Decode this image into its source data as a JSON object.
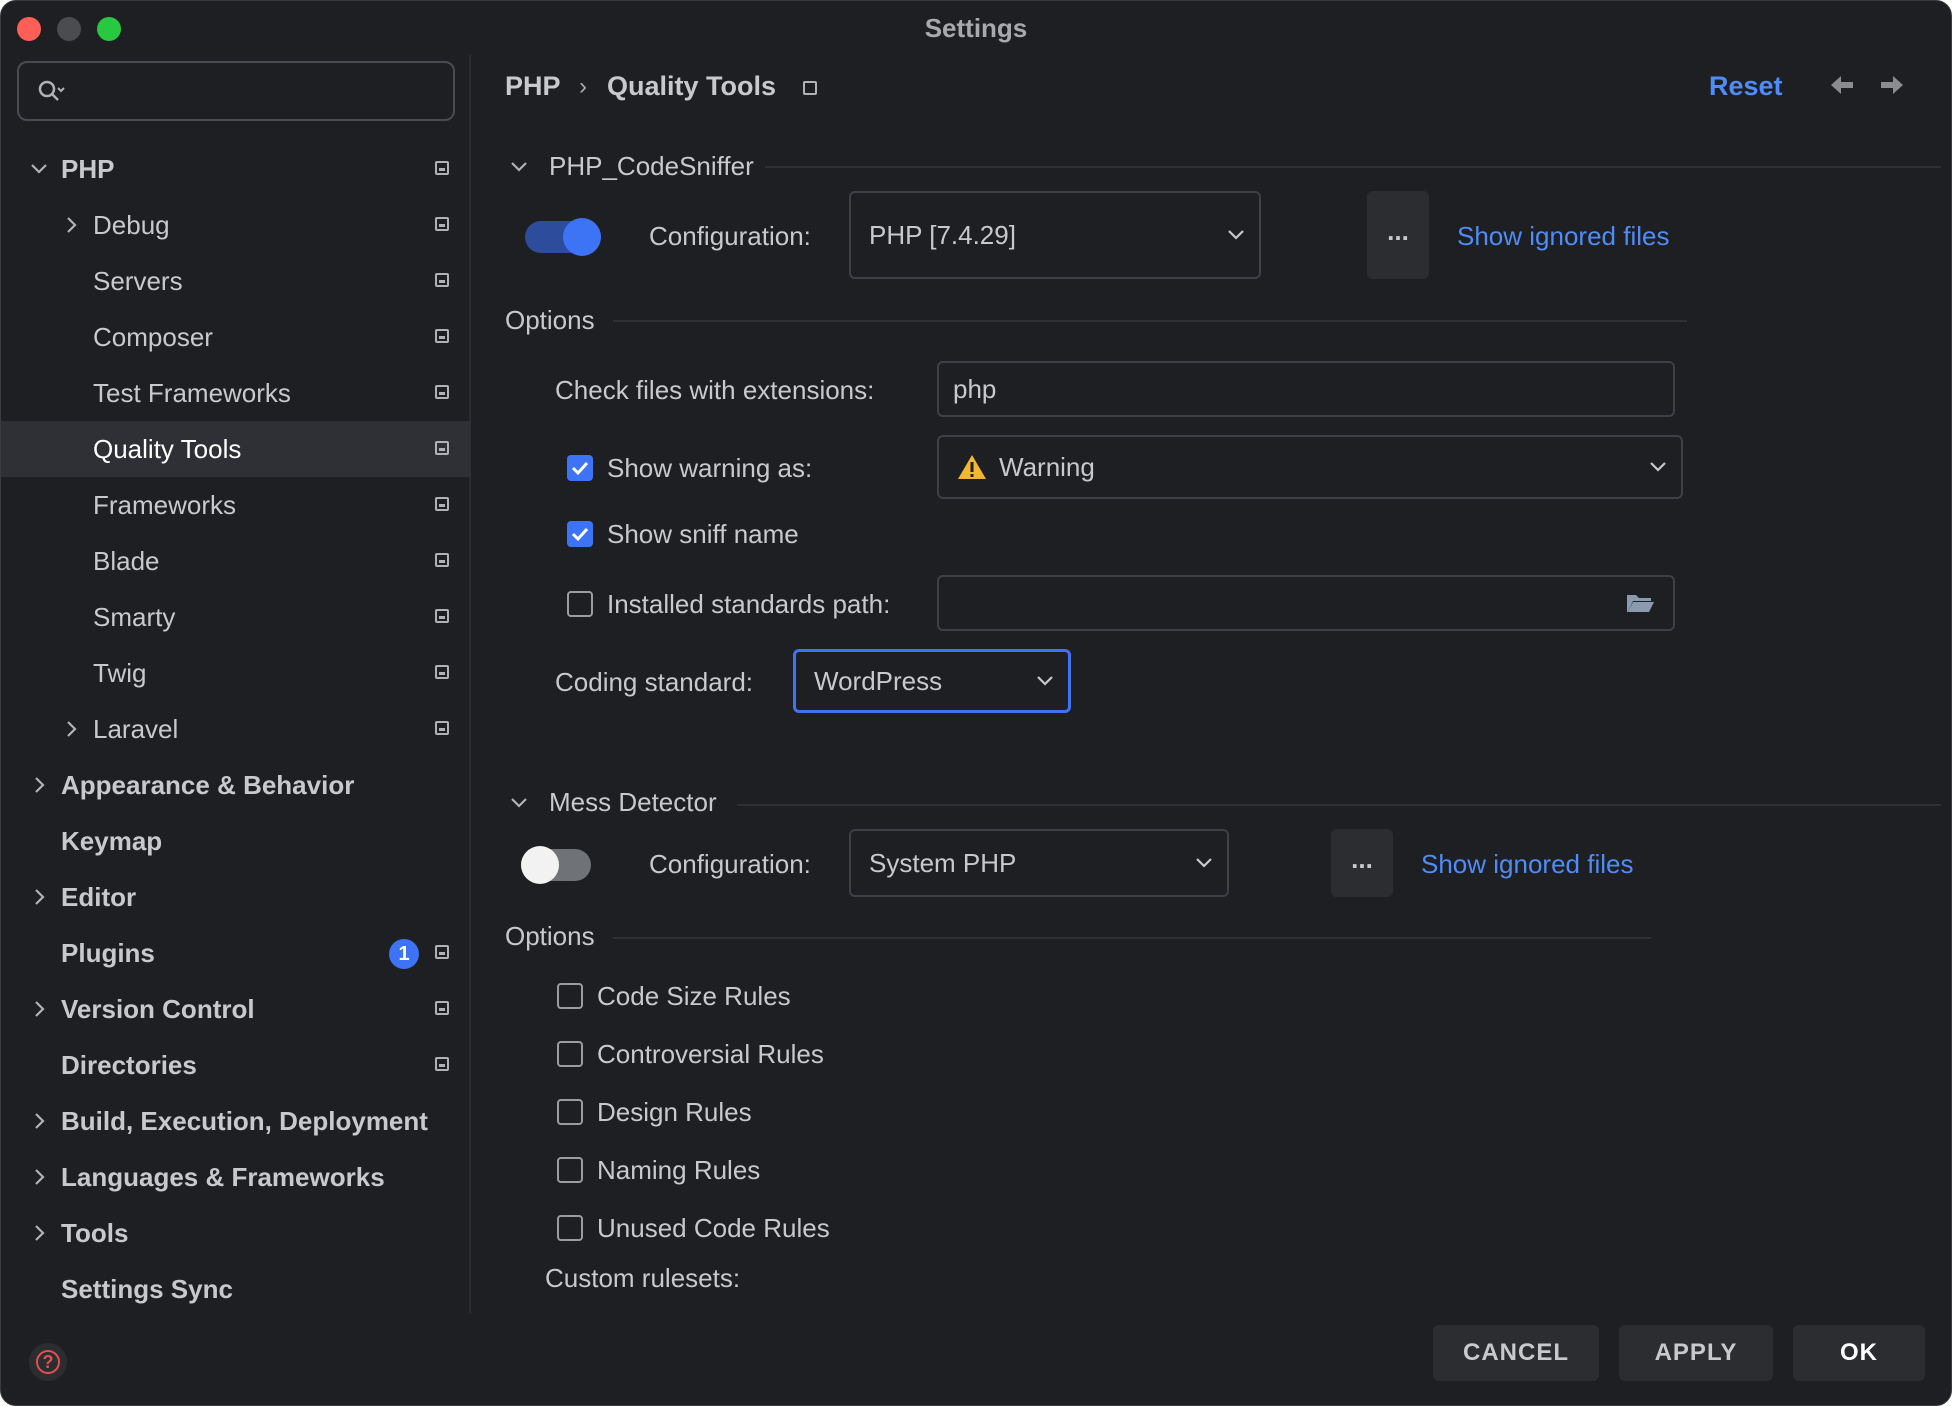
{
  "window": {
    "title": "Settings"
  },
  "sidebar": {
    "search_placeholder": "",
    "items": [
      {
        "label": "PHP",
        "expanded": true
      },
      {
        "label": "Debug"
      },
      {
        "label": "Servers"
      },
      {
        "label": "Composer"
      },
      {
        "label": "Test Frameworks"
      },
      {
        "label": "Quality Tools",
        "selected": true
      },
      {
        "label": "Frameworks"
      },
      {
        "label": "Blade"
      },
      {
        "label": "Smarty"
      },
      {
        "label": "Twig"
      },
      {
        "label": "Laravel"
      },
      {
        "label": "Appearance & Behavior"
      },
      {
        "label": "Keymap"
      },
      {
        "label": "Editor"
      },
      {
        "label": "Plugins",
        "badge": "1"
      },
      {
        "label": "Version Control"
      },
      {
        "label": "Directories"
      },
      {
        "label": "Build, Execution, Deployment"
      },
      {
        "label": "Languages & Frameworks"
      },
      {
        "label": "Tools"
      },
      {
        "label": "Settings Sync"
      }
    ]
  },
  "header": {
    "breadcrumb_parent": "PHP",
    "breadcrumb_current": "Quality Tools",
    "reset_label": "Reset"
  },
  "codesniffer": {
    "title": "PHP_CodeSniffer",
    "enabled": true,
    "config_label": "Configuration:",
    "config_value": "PHP [7.4.29]",
    "more_label": "...",
    "show_ignored": "Show ignored files",
    "options_title": "Options",
    "extensions_label": "Check files with extensions:",
    "extensions_value": "php",
    "show_warning_label": "Show warning as:",
    "show_warning_checked": true,
    "warning_value": "Warning",
    "show_sniff_label": "Show sniff name",
    "show_sniff_checked": true,
    "installed_path_label": "Installed standards path:",
    "installed_path_checked": false,
    "installed_path_value": "",
    "coding_standard_label": "Coding standard:",
    "coding_standard_value": "WordPress"
  },
  "mess_detector": {
    "title": "Mess Detector",
    "enabled": false,
    "config_label": "Configuration:",
    "config_value": "System PHP",
    "more_label": "...",
    "show_ignored": "Show ignored files",
    "options_title": "Options",
    "rules": [
      {
        "label": "Code Size Rules",
        "checked": false
      },
      {
        "label": "Controversial Rules",
        "checked": false
      },
      {
        "label": "Design Rules",
        "checked": false
      },
      {
        "label": "Naming Rules",
        "checked": false
      },
      {
        "label": "Unused Code Rules",
        "checked": false
      }
    ],
    "custom_rulesets_label": "Custom rulesets:"
  },
  "footer": {
    "cancel": "CANCEL",
    "apply": "APPLY",
    "ok": "OK"
  },
  "colors": {
    "accent": "#3d74f5",
    "link": "#4f8cf7",
    "background": "#1e1f22",
    "warning": "#f2b632",
    "help": "#e0524f"
  }
}
